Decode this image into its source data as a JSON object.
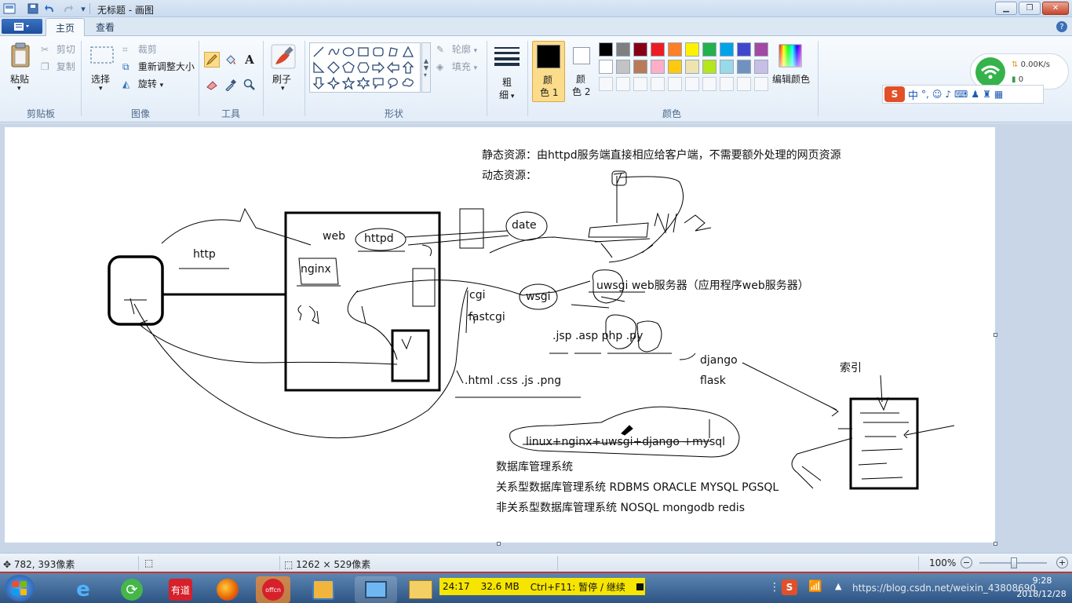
{
  "window": {
    "title": "无标题 - 画图"
  },
  "tabs": {
    "home": "主页",
    "view": "查看"
  },
  "ribbon": {
    "clipboard": {
      "paste": "粘贴",
      "cut": "剪切",
      "copy": "复制",
      "label": "剪贴板"
    },
    "image": {
      "select": "选择",
      "crop": "裁剪",
      "resize": "重新调整大小",
      "rotate": "旋转",
      "label": "图像"
    },
    "tools": {
      "label": "工具"
    },
    "brushes": {
      "label": "刷子"
    },
    "shapes": {
      "outline": "轮廓",
      "fill": "填充",
      "label": "形状"
    },
    "size": {
      "label_line1": "粗",
      "label_line2": "细"
    },
    "colors": {
      "color1_line1": "颜",
      "color1_line2": "色 1",
      "color2_line1": "颜",
      "color2_line2": "色 2",
      "edit": "编辑颜色",
      "label": "颜色",
      "palette_row1": [
        "#000000",
        "#7f7f7f",
        "#880015",
        "#ed1c24",
        "#ff7f27",
        "#fff200",
        "#22b14c",
        "#00a2e8",
        "#3f48cc",
        "#a349a4"
      ],
      "palette_row2": [
        "#ffffff",
        "#c3c3c3",
        "#b97a57",
        "#ffaec9",
        "#ffc90e",
        "#efe4b0",
        "#b5e61d",
        "#99d9ea",
        "#7092be",
        "#c8bfe7"
      ]
    }
  },
  "canvas_text": {
    "static_res": "静态资源：由httpd服务端直接相应给客户端，不需要额外处理的网页资源",
    "dynamic_res": "动态资源：",
    "http": "http",
    "web": "web",
    "httpd": "httpd",
    "nginx": "nginx",
    "date": "date",
    "uwsgi_line": "uwsgi   web服务器（应用程序web服务器）",
    "cgi": "cgi",
    "fastcgi": "fastcgi",
    "wsgi": "wsgi",
    "jsp_line": ".jsp  .asp  php  .py",
    "django": "django",
    "flask": "flask",
    "index": "索引",
    "html_line": ".html .css .js  .png",
    "stack": "linux+nginx+uwsgi+django +mysql",
    "db_mgmt": "数据库管理系统",
    "rdbms": "关系型数据库管理系统  RDBMS   ORACLE  MYSQL  PGSQL",
    "nosql": "非关系型数据库管理系统   NOSQL    mongodb   redis"
  },
  "status": {
    "cursor": "782, 393像素",
    "canvas_size": "1262 × 529像素",
    "zoom": "100%"
  },
  "taskbar": {
    "recorder_time": "24:17",
    "recorder_size": "32.6 MB",
    "recorder_hint": "Ctrl+F11: 暂停 / 继续",
    "clock_time": "9:28",
    "clock_date": "2018/12/28",
    "watermark": "https://blog.csdn.net/weixin_43808690"
  },
  "net_widget": {
    "speed": "0.00K/s",
    "count": "0"
  }
}
